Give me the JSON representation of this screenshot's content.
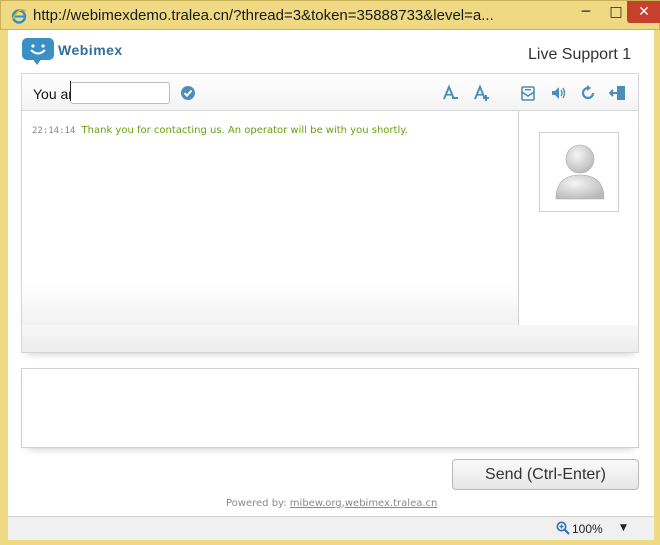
{
  "window": {
    "url_title": "http://webimexdemo.tralea.cn/?thread=3&token=35888733&level=a...",
    "minimize_glyph": "─",
    "maximize_glyph": "□",
    "close_glyph": "✕"
  },
  "header": {
    "logo_text": "Webimex",
    "title": "Live Support 1"
  },
  "toolbar": {
    "name_label": "You are",
    "name_value": "",
    "icons": [
      "font-smaller-icon",
      "font-larger-icon",
      "mail-icon",
      "sound-icon",
      "refresh-icon",
      "exit-icon"
    ]
  },
  "chat": {
    "messages": [
      {
        "time": "22:14:14",
        "text": "Thank you for contacting us. An operator will be with you shortly."
      }
    ]
  },
  "composer": {
    "send_label": "Send (Ctrl-Enter)"
  },
  "footer": {
    "powered_label": "Powered by:",
    "link1": "mibew.org",
    "separator": ",",
    "link2": "webimex.tralea.cn"
  },
  "statusbar": {
    "zoom": "100%",
    "zoom_arrow": "▼"
  },
  "colors": {
    "frame": "#efd983",
    "brand_blue": "#3a8fc4",
    "message_green": "#6aa00f",
    "close_red": "#c7402d"
  }
}
